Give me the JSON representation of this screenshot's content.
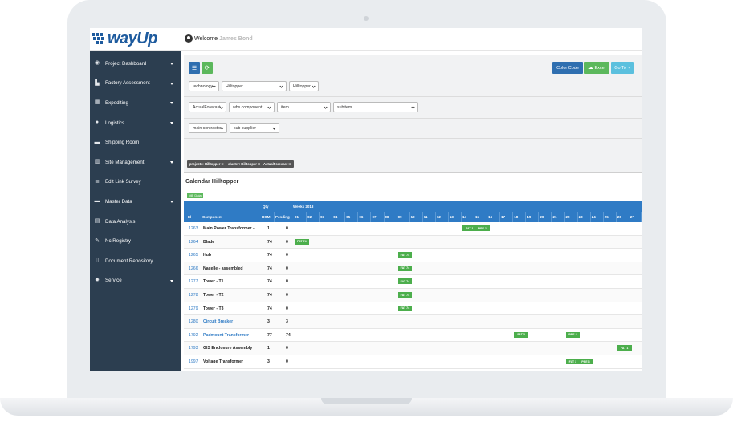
{
  "app": {
    "logo_text": "wayUp",
    "welcome_label": "Welcome",
    "user_name": "James Bond"
  },
  "sidebar": {
    "items": [
      {
        "label": "Project Dashboard",
        "icon": "dashboard-icon",
        "caret": true
      },
      {
        "label": "Factory Assessment",
        "icon": "factory-icon",
        "caret": true
      },
      {
        "label": "Expediting",
        "icon": "calendar-icon",
        "caret": true
      },
      {
        "label": "Logistics",
        "icon": "globe-icon",
        "caret": true
      },
      {
        "label": "Shipping Room",
        "icon": "truck-icon",
        "caret": false
      },
      {
        "label": "Site Management",
        "icon": "building-icon",
        "caret": true
      },
      {
        "label": "Edit Link Survey",
        "icon": "list-icon",
        "caret": false
      },
      {
        "label": "Master Data",
        "icon": "truck-icon",
        "caret": true
      },
      {
        "label": "Data Analysis",
        "icon": "table-icon",
        "caret": false
      },
      {
        "label": "Nc Registry",
        "icon": "edit-icon",
        "caret": false
      },
      {
        "label": "Document Repository",
        "icon": "document-icon",
        "caret": false
      },
      {
        "label": "Service",
        "icon": "gear-icon",
        "caret": true
      }
    ]
  },
  "toolbar": {
    "filter_icon": "sliders-icon",
    "refresh_icon": "refresh-icon",
    "color_code": "Color Code",
    "excel": "Excel",
    "goto": "Go To"
  },
  "filters": {
    "row1": [
      "technology",
      "Hilltopper",
      "Hilltopper"
    ],
    "row2": [
      "ActualForecast",
      "wbs component",
      "item",
      "subitem"
    ],
    "row3": [
      "main contractor",
      "sub supplier"
    ]
  },
  "tags": [
    "projects: Hilltopper",
    "cluster: Hilltopper",
    "ActualForecast"
  ],
  "calendar": {
    "title": "Calendar Hilltopper",
    "badge": "MB Data",
    "header_top": {
      "qty": "Qty",
      "weeks": "Weeks 2018"
    },
    "header_cols": {
      "id": "Id",
      "component": "Component",
      "bom": "BOM",
      "pending": "Pending"
    },
    "weeks": [
      "01",
      "02",
      "03",
      "04",
      "05",
      "06",
      "07",
      "08",
      "09",
      "10",
      "11",
      "12",
      "13",
      "14",
      "15",
      "16",
      "17",
      "18",
      "19",
      "20",
      "21",
      "22",
      "23",
      "24",
      "25",
      "26",
      "27"
    ],
    "rows": [
      {
        "id": "1263",
        "component": "Main Power Transformer - ...",
        "bom": "1",
        "pending": "0",
        "link": false,
        "events": [
          {
            "label": "FAT 1",
            "week": 14
          },
          {
            "label": "PRE 1",
            "week": 15
          }
        ]
      },
      {
        "id": "1264",
        "component": "Blade",
        "bom": "74",
        "pending": "0",
        "link": false,
        "events": [
          {
            "label": "FAT 74",
            "week": 1
          }
        ]
      },
      {
        "id": "1265",
        "component": "Hub",
        "bom": "74",
        "pending": "0",
        "link": false,
        "events": [
          {
            "label": "FAT 74",
            "week": 9
          }
        ]
      },
      {
        "id": "1266",
        "component": "Nacelle - assembled",
        "bom": "74",
        "pending": "0",
        "link": false,
        "events": [
          {
            "label": "FAT 74",
            "week": 9
          }
        ]
      },
      {
        "id": "1277",
        "component": "Tower - T1",
        "bom": "74",
        "pending": "0",
        "link": false,
        "events": [
          {
            "label": "FAT 74",
            "week": 9
          }
        ]
      },
      {
        "id": "1278",
        "component": "Tower - T2",
        "bom": "74",
        "pending": "0",
        "link": false,
        "events": [
          {
            "label": "FAT 74",
            "week": 9
          }
        ]
      },
      {
        "id": "1279",
        "component": "Tower - T3",
        "bom": "74",
        "pending": "0",
        "link": false,
        "events": [
          {
            "label": "FAT 74",
            "week": 9
          }
        ]
      },
      {
        "id": "1280",
        "component": "Circuit Breaker",
        "bom": "3",
        "pending": "3",
        "link": true,
        "events": []
      },
      {
        "id": "1792",
        "component": "Padmount Transformer",
        "bom": "77",
        "pending": "74",
        "link": true,
        "events": [
          {
            "label": "FAT 3",
            "week": 18
          },
          {
            "label": "PRE 3",
            "week": 22
          }
        ]
      },
      {
        "id": "1793",
        "component": "GIS Enclosure Assembly",
        "bom": "1",
        "pending": "0",
        "link": false,
        "events": [
          {
            "label": "FAT 1",
            "week": 26
          }
        ]
      },
      {
        "id": "1997",
        "component": "Voltage Transformer",
        "bom": "3",
        "pending": "0",
        "link": false,
        "events": [
          {
            "label": "FAT 3",
            "week": 22
          },
          {
            "label": "PRE 3",
            "week": 23
          }
        ]
      }
    ]
  },
  "colors": {
    "sidebar_bg": "#2c3e50",
    "brand_blue": "#1e5b9e",
    "table_header": "#2f7bc5",
    "event_green": "#4cae4c",
    "color_code_btn": "#2f6fb0",
    "excel_btn": "#5cb85c",
    "goto_btn": "#5bc0de"
  }
}
